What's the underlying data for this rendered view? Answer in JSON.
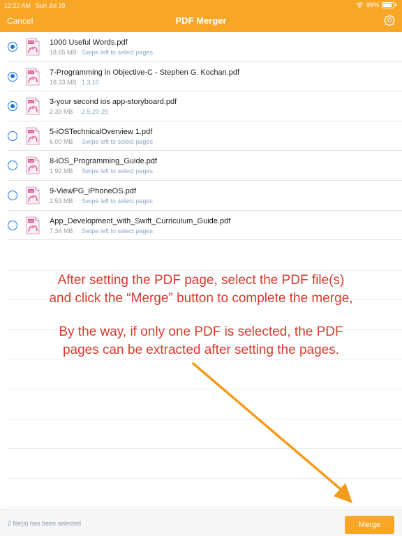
{
  "status_bar": {
    "time": "12:22 AM",
    "date": "Sun Jul 19",
    "battery": "86%",
    "battery_level": 0.86,
    "wifi_icon": "wifi-icon"
  },
  "nav": {
    "cancel_label": "Cancel",
    "title": "PDF Merger",
    "settings_icon": "gear-icon"
  },
  "files": [
    {
      "name": "1000 Useful Words.pdf",
      "size": "18.65 MB",
      "pages": "Swipe left to select pages",
      "selected": true
    },
    {
      "name": "7-Programming in Objective-C - Stephen G. Kochan.pdf",
      "size": "18.33 MB",
      "pages": "1,3,10",
      "selected": true
    },
    {
      "name": "3-your second ios app-storyboard.pdf",
      "size": "2.39 MB",
      "pages": "2,5,20-25",
      "selected": true
    },
    {
      "name": "5-iOSTechnicalOverview 1.pdf",
      "size": "6.00 MB",
      "pages": "Swipe left to select pages",
      "selected": false
    },
    {
      "name": "8-iOS_Programming_Guide.pdf",
      "size": "1.92 MB",
      "pages": "Swipe left to select pages",
      "selected": false
    },
    {
      "name": "9-ViewPG_iPhoneOS.pdf",
      "size": "2.53 MB",
      "pages": "Swipe left to select pages",
      "selected": false
    },
    {
      "name": "App_Development_with_Swift_Curriculum_Guide.pdf",
      "size": "7.34 MB",
      "pages": "Swipe left to select pages",
      "selected": false
    }
  ],
  "hint": {
    "line1": "After setting the PDF page, select the PDF file(s)",
    "line2": "and click the “Merge” button to complete the merge,",
    "line3": "By the way, if only one PDF is selected, the PDF",
    "line4": "pages can be extracted after setting the pages."
  },
  "footer": {
    "selected_text": "2 file(s) has been selected",
    "merge_label": "Merge"
  },
  "colors": {
    "accent": "#f8a626",
    "radio": "#1a73d9",
    "hint_text": "#d83a2c",
    "arrow": "#f39b1a"
  }
}
